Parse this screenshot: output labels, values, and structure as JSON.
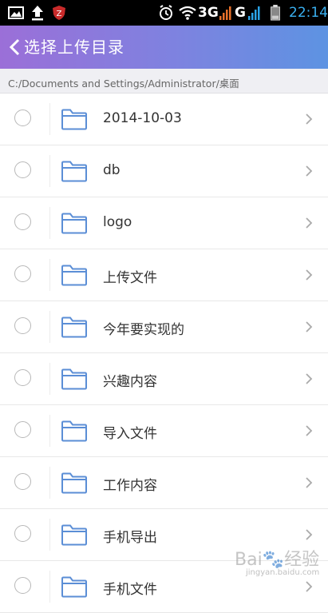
{
  "status_bar": {
    "network_3g": "3G",
    "network_g": "G",
    "time": "22:14",
    "icons": [
      "image-icon",
      "upload-icon",
      "shield-z-icon",
      "alarm-icon",
      "wifi-icon",
      "signal-icon",
      "battery-icon"
    ],
    "accent_3g": "#e8702a",
    "accent_g": "#2aa3e8"
  },
  "header": {
    "title": "选择上传目录",
    "gradient": [
      "#9b6fd8",
      "#5d93e2"
    ]
  },
  "path": "C:/Documents and Settings/Administrator/桌面",
  "folders": [
    "2014-10-03",
    "db",
    "logo",
    "上传文件",
    "今年要实现的",
    "兴趣内容",
    "导入文件",
    "工作内容",
    "手机导出",
    "手机文件"
  ],
  "colors": {
    "folder": "#5b8ed6"
  }
}
